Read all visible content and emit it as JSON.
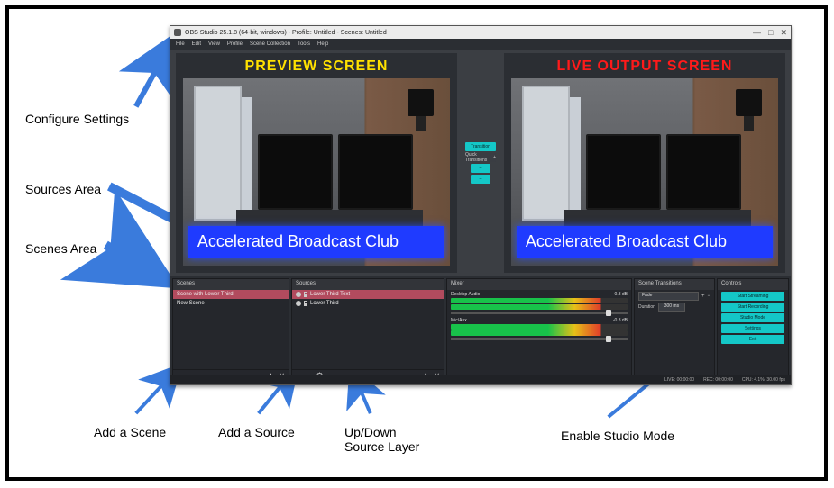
{
  "annotations": {
    "configure_settings": "Configure Settings",
    "sources_area": "Sources Area",
    "scenes_area": "Scenes Area",
    "add_scene": "Add a Scene",
    "add_source": "Add a Source",
    "updown_layer": "Up/Down\nSource Layer",
    "enable_studio": "Enable Studio Mode"
  },
  "preview_label": "PREVIEW SCREEN",
  "live_label": "LIVE OUTPUT SCREEN",
  "lower_third_text": "Accelerated Broadcast Club",
  "window": {
    "title": "OBS Studio 25.1.8 (64-bit, windows) - Profile: Untitled - Scenes: Untitled",
    "menu": [
      "File",
      "Edit",
      "View",
      "Profile",
      "Scene Collection",
      "Tools",
      "Help"
    ]
  },
  "center_buttons": {
    "transition": "Transition",
    "quick": "Quick Transitions",
    "plus": "+",
    "minus1": "–",
    "minus2": "–"
  },
  "scenes": {
    "header": "Scenes",
    "items": [
      "Scene with Lower Third",
      "New Scene"
    ],
    "selected": 0
  },
  "sources": {
    "header": "Sources",
    "items": [
      "Lower Third Text",
      "Lower Third"
    ],
    "selected": 0
  },
  "mixer": {
    "header": "Mixer",
    "tracks": [
      {
        "name": "Desktop Audio",
        "level": "-0.3 dB",
        "knob_pct": 88
      },
      {
        "name": "Mic/Aux",
        "level": "-0.3 dB",
        "knob_pct": 88
      }
    ]
  },
  "transitions": {
    "header": "Scene Transitions",
    "selected": "Fade",
    "duration_label": "Duration",
    "duration_value": "300 ms"
  },
  "controls": {
    "header": "Controls",
    "buttons": [
      "Start Streaming",
      "Start Recording",
      "Studio Mode",
      "Settings",
      "Exit"
    ]
  },
  "status": {
    "live": "LIVE: 00:00:00",
    "rec": "REC: 00:00:00",
    "cpu": "CPU: 4.1%, 30.00 fps"
  }
}
